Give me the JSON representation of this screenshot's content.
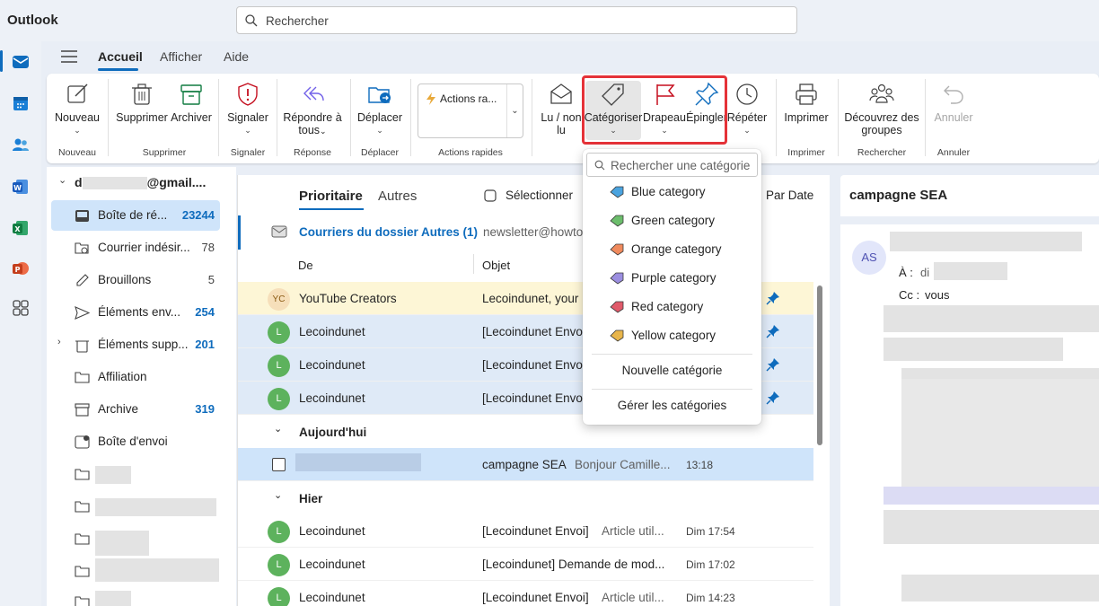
{
  "app": {
    "title": "Outlook"
  },
  "search": {
    "placeholder": "Rechercher"
  },
  "tabs": [
    {
      "label": "Accueil"
    },
    {
      "label": "Afficher"
    },
    {
      "label": "Aide"
    }
  ],
  "ribbon": {
    "nouveau": "Nouveau",
    "supprimer": "Supprimer",
    "archiver": "Archiver",
    "signaler": "Signaler",
    "repondre_l1": "Répondre à",
    "repondre_l2": "tous",
    "deplacer": "Déplacer",
    "actions_rapides": "Actions ra...",
    "lu_l1": "Lu / non",
    "lu_l2": "lu",
    "categoriser": "Catégoriser",
    "drapeau": "Drapeau",
    "epingler": "Épingler",
    "repeter": "Répéter",
    "imprimer": "Imprimer",
    "decouvrez_l1": "Découvrez des",
    "decouvrez_l2": "groupes",
    "annuler": "Annuler",
    "groups": {
      "nouveau": "Nouveau",
      "supprimer": "Supprimer",
      "signaler": "Signaler",
      "reponse": "Réponse",
      "deplacer": "Déplacer",
      "actions_rapides": "Actions rapides",
      "imprimer": "Imprimer",
      "rechercher": "Rechercher",
      "annuler": "Annuler"
    }
  },
  "folders": {
    "account": "d",
    "account_suffix": "@gmail....",
    "items": [
      {
        "label": "Boîte de ré...",
        "count": "23244"
      },
      {
        "label": "Courrier indésir...",
        "count": "78"
      },
      {
        "label": "Brouillons",
        "count": "5"
      },
      {
        "label": "Éléments env...",
        "count": "254"
      },
      {
        "label": "Éléments supp...",
        "count": "201"
      },
      {
        "label": "Affiliation",
        "count": ""
      },
      {
        "label": "Archive",
        "count": "319"
      },
      {
        "label": "Boîte d'envoi",
        "count": ""
      }
    ]
  },
  "list": {
    "tab_focused": "Prioritaire",
    "tab_other": "Autres",
    "select": "Sélectionner",
    "sort": "Par Date",
    "other_banner": "Courriers du dossier Autres (1)",
    "other_sender": "newsletter@howto",
    "col_from": "De",
    "col_subject": "Objet",
    "rows": [
      {
        "avatar": "YC",
        "sender": "YouTube Creators",
        "subject": "Lecoindunet, your",
        "preview": "",
        "date": ""
      },
      {
        "avatar": "L",
        "sender": "Lecoindunet",
        "subject": "[Lecoindunet Envo",
        "preview": "",
        "date": ""
      },
      {
        "avatar": "L",
        "sender": "Lecoindunet",
        "subject": "[Lecoindunet Envo",
        "preview": "",
        "date": ""
      },
      {
        "avatar": "L",
        "sender": "Lecoindunet",
        "subject": "[Lecoindunet Envo",
        "preview": "",
        "date": ""
      }
    ],
    "group_today": "Aujourd'hui",
    "today_row": {
      "subject": "campagne SEA",
      "preview": "Bonjour Camille...",
      "date": "13:18"
    },
    "group_yesterday": "Hier",
    "yesterday_rows": [
      {
        "avatar": "L",
        "sender": "Lecoindunet",
        "subject": "[Lecoindunet Envoi]",
        "preview": "Article util...",
        "date": "Dim 17:54"
      },
      {
        "avatar": "L",
        "sender": "Lecoindunet",
        "subject": "[Lecoindunet] Demande de mod...",
        "preview": "",
        "date": "Dim 17:02"
      },
      {
        "avatar": "L",
        "sender": "Lecoindunet",
        "subject": "[Lecoindunet Envoi]",
        "preview": "Article util...",
        "date": "Dim 14:23"
      }
    ]
  },
  "reading": {
    "title": "campagne SEA",
    "avatar": "AS",
    "to_label": "À :",
    "to_value": "di",
    "cc_label": "Cc :",
    "cc_value": "vous"
  },
  "category_menu": {
    "search_placeholder": "Rechercher une catégorie",
    "items": [
      {
        "label": "Blue category",
        "color": "#4aa3df"
      },
      {
        "label": "Green category",
        "color": "#6cbd6c"
      },
      {
        "label": "Orange category",
        "color": "#f08a5d"
      },
      {
        "label": "Purple category",
        "color": "#9b8ee0"
      },
      {
        "label": "Red category",
        "color": "#e05a6a"
      },
      {
        "label": "Yellow category",
        "color": "#e8b54a"
      }
    ],
    "new": "Nouvelle catégorie",
    "manage": "Gérer les catégories"
  },
  "colors": {
    "accent": "#0f6cbd",
    "highlight_box": "#e53238"
  }
}
